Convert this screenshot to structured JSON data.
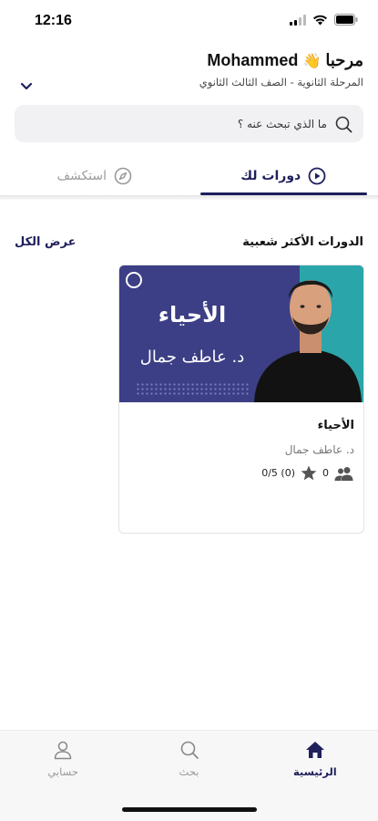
{
  "status_bar": {
    "time": "12:16"
  },
  "header": {
    "greeting": "مرحبا",
    "wave_emoji": "👋",
    "user_name": "Mohammed",
    "stage": "المرحلة الثانوية - الصف الثالث الثانوي"
  },
  "search": {
    "placeholder": "ما الذي تبحث عنه ؟"
  },
  "tabs": [
    {
      "label": "دورات لك",
      "icon": "play-circle-icon",
      "active": true
    },
    {
      "label": "استكشف",
      "icon": "compass-icon",
      "active": false
    }
  ],
  "popular": {
    "title": "الدورات الأكثر شعبية",
    "view_all": "عرض الكل",
    "courses": [
      {
        "thumb_subject": "الأحياء",
        "thumb_teacher": "د. عاطف جمال",
        "name": "الأحياء",
        "teacher": "د. عاطف جمال",
        "students": "0",
        "rating": "(0) 0/5"
      }
    ]
  },
  "bottom_nav": [
    {
      "label": "الرئيسية",
      "icon": "home-icon",
      "active": true
    },
    {
      "label": "بحث",
      "icon": "search-icon",
      "active": false
    },
    {
      "label": "حسابي",
      "icon": "user-icon",
      "active": false
    }
  ],
  "colors": {
    "primary": "#1f1f5c",
    "thumb_bg": "#3c3f85",
    "thumb_accent": "#2aa6aa"
  }
}
